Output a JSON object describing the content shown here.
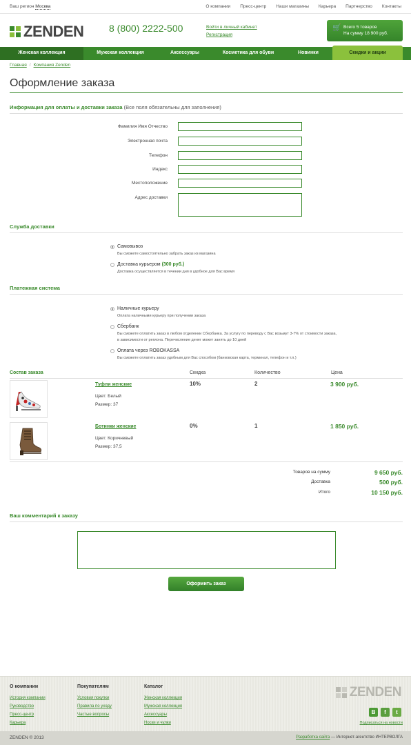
{
  "topbar": {
    "region_label": "Ваш регион",
    "region_value": "Москва",
    "links": [
      "О компании",
      "Пресс-центр",
      "Наши магазины",
      "Карьера",
      "Партнерство",
      "Контакты"
    ]
  },
  "header": {
    "logo_text": "ZENDEN",
    "phone": "8 (800) 2222-500",
    "login_link": "Войти в личный кабинет",
    "register_link": "Регистрация",
    "cart_line1": "Всего 5 товаров",
    "cart_line2": "На сумму 18 900 руб."
  },
  "nav": [
    "Женская коллекция",
    "Мужская коллекция",
    "Аксессуары",
    "Косметика для обуви",
    "Новинки",
    "Скидки и акции"
  ],
  "breadcrumb": [
    "Главная",
    "Компания Zenden"
  ],
  "page_title": "Оформление заказа",
  "billing": {
    "heading": "Информация для оплаты и доставки заказа",
    "note": "(Все поля обязательны для заполнения)",
    "fields": [
      {
        "label": "Фамилия Имя Отчество",
        "value": ""
      },
      {
        "label": "Электронная почта",
        "value": ""
      },
      {
        "label": "Телефон",
        "value": ""
      },
      {
        "label": "Индекс",
        "value": ""
      },
      {
        "label": "Местоположение",
        "value": ""
      },
      {
        "label": "Адрес доставки",
        "value": ""
      }
    ]
  },
  "delivery": {
    "heading": "Служба доставки",
    "options": [
      {
        "title": "Самовывоз",
        "price": "",
        "desc": "Вы сможете самостоятельно забрать заказ из магазина",
        "selected": true
      },
      {
        "title": "Доставка курьером",
        "price": "(300 руб.)",
        "desc": "Доставка осуществляется в течении дня в удобное для Вас время",
        "selected": false
      }
    ]
  },
  "payment": {
    "heading": "Платежная система",
    "options": [
      {
        "title": "Наличные курьеру",
        "desc": "Оплата наличными курьеру при получении заказа",
        "selected": true
      },
      {
        "title": "Сбербанк",
        "desc": "Вы сможете оплатить заказ в любом отделении Сбербанка. За услугу по переводу с Вас возьмут 3-7% от стоимости заказа, в зависимости от региона. Перечисление денег может занять до 10 дней",
        "selected": false
      },
      {
        "title": "Оплата через ROBOKASSA",
        "desc": "Вы сможете оплатить заказ удобным для Вас способом (банковская карта, терминал, телефон и т.п.)",
        "selected": false
      }
    ]
  },
  "order": {
    "heading": "Состав заказа",
    "columns": [
      "Скидка",
      "Количество",
      "Цена"
    ],
    "items": [
      {
        "name": "Туфли женские",
        "color": "Цвет: Белый",
        "size": "Размер: 37",
        "discount": "10%",
        "qty": "2",
        "price": "3 900 руб."
      },
      {
        "name": "Ботинки женские",
        "color": "Цвет: Коричневый",
        "size": "Размер: 37,5",
        "discount": "0%",
        "qty": "1",
        "price": "1 850 руб."
      }
    ],
    "totals": [
      {
        "label": "Товаров на сумму",
        "value": "9 650 руб."
      },
      {
        "label": "Доставка",
        "value": "500 руб."
      },
      {
        "label": "Итого",
        "value": "10 150 руб."
      }
    ]
  },
  "comment": {
    "heading": "Ваш комментарий к заказу",
    "value": ""
  },
  "submit_label": "Оформить заказ",
  "footer": {
    "columns": [
      {
        "title": "О компании",
        "links": [
          "История компании",
          "Руководство",
          "Пресс-центр",
          "Карьера"
        ]
      },
      {
        "title": "Покупателям",
        "links": [
          "Условия покупки",
          "Правила по уходу",
          "Частые вопросы"
        ]
      },
      {
        "title": "Каталог",
        "links": [
          "Женская коллекция",
          "Мужская коллекция",
          "Аксессуары",
          "Носки и чулки"
        ]
      }
    ],
    "logo_text": "ZENDEN",
    "socials": [
      "В",
      "f",
      "t"
    ],
    "subscribe": "Подписаться на новости",
    "copyright": "ZENDEN © 2013",
    "agency_link": "Разработка сайта",
    "agency_text": "— Интернет-агентство ИНТЕРВОЛГА"
  },
  "colors": {
    "brand_green": "#3a8a2c",
    "promo_green": "#8bc13c"
  }
}
